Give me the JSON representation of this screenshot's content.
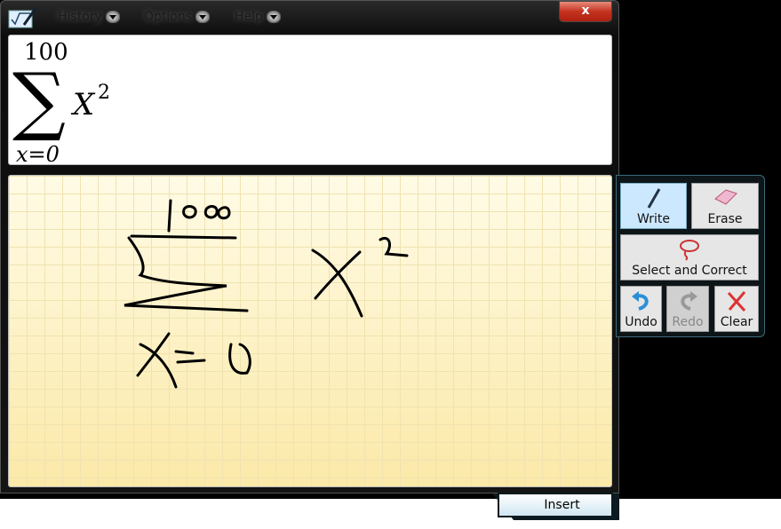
{
  "window": {
    "menu": [
      {
        "label": "History"
      },
      {
        "label": "Options"
      },
      {
        "label": "Help"
      }
    ],
    "close_label": "x"
  },
  "preview": {
    "upper": "100",
    "lower": "x=0",
    "variable": "X",
    "exponent": "2"
  },
  "tools": {
    "write": {
      "label": "Write",
      "icon": "pen-icon",
      "active": true
    },
    "erase": {
      "label": "Erase",
      "icon": "eraser-icon"
    },
    "select": {
      "label": "Select and Correct",
      "icon": "lasso-icon"
    },
    "undo": {
      "label": "Undo",
      "icon": "undo-icon"
    },
    "redo": {
      "label": "Redo",
      "icon": "redo-icon",
      "disabled": true
    },
    "clear": {
      "label": "Clear",
      "icon": "clear-icon"
    }
  },
  "insert_label": "Insert",
  "colors": {
    "accent": "#cce8ff",
    "pad": "#fdf2c0",
    "close": "#c4331f"
  }
}
